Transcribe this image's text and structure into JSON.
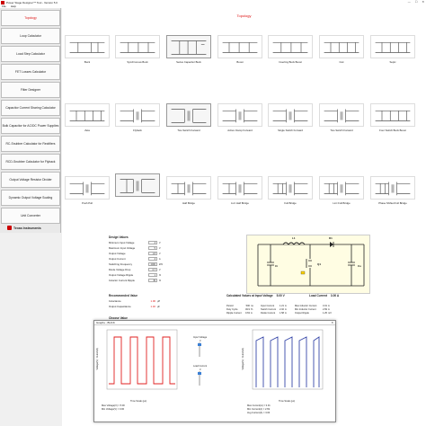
{
  "window": {
    "title": "Power Stage Designer™ Tool - Version 5.0",
    "minimize": "—",
    "maximize": "☐",
    "close": "✕"
  },
  "menu": [
    "File",
    "Help"
  ],
  "sidebar": {
    "items": [
      {
        "label": "Topology",
        "active": true
      },
      {
        "label": "Loop Calculator"
      },
      {
        "label": "Load Step Calculator"
      },
      {
        "label": "FET Losses Calculator"
      },
      {
        "label": "Filter Designer"
      },
      {
        "label": "Capacitor Current Sharing Calculator"
      },
      {
        "label": "Bulk Capacitor for AC/DC Power Supplies"
      },
      {
        "label": "RC-Snubber Calculator for Rectifiers"
      },
      {
        "label": "RCD-Snubber Calculator for Flyback"
      },
      {
        "label": "Output Voltage Resistor Divider"
      },
      {
        "label": "Dynamic Output Voltage Scaling"
      },
      {
        "label": "Unit Converter"
      }
    ],
    "logo_text": "Texas Instruments"
  },
  "main": {
    "title": "Topology",
    "topologies": [
      {
        "label": "Buck"
      },
      {
        "label": "Synchronous Buck"
      },
      {
        "label": "Series Capacitor Buck"
      },
      {
        "label": "Boost"
      },
      {
        "label": "Inverting Buck Boost"
      },
      {
        "label": "Cuk"
      },
      {
        "label": "Sepic"
      },
      {
        "label": "Zeta"
      },
      {
        "label": "Flyback"
      },
      {
        "label": "Two Switch Forward"
      },
      {
        "label": "Active Clamp Forward"
      },
      {
        "label": "Single Switch Forward"
      },
      {
        "label": "Two Switch Forward"
      },
      {
        "label": "Four Switch Buck Boost"
      },
      {
        "label": "Push Pull"
      },
      {
        "label": "Half Bridge"
      },
      {
        "label": "LLC Half Bridge"
      },
      {
        "label": "Full Bridge"
      },
      {
        "label": "LLC Full Bridge"
      },
      {
        "label": "Phase Shifted Full Bridge"
      }
    ],
    "design_values": {
      "heading": "Design Values",
      "rows": [
        {
          "label": "Minimum Input Voltage",
          "value": "3",
          "unit": "V"
        },
        {
          "label": "Maximum Input Voltage",
          "value": "5",
          "unit": "V"
        },
        {
          "label": "Output Voltage",
          "value": "1.8",
          "unit": "V"
        },
        {
          "label": "Output Current",
          "value": "3",
          "unit": "A"
        },
        {
          "label": "Switching Frequency",
          "value": "2000",
          "unit": "kHz"
        },
        {
          "label": "Diode Voltage Drop",
          "value": "0.7",
          "unit": "V"
        },
        {
          "label": "Output Voltage Ripple",
          "value": "1",
          "unit": "%"
        },
        {
          "label": "Inductor Current Ripple",
          "value": "30",
          "unit": "%"
        }
      ]
    },
    "recommended": {
      "heading": "Recommended Value",
      "rows": [
        {
          "label": "Inductance",
          "value": "1.06",
          "unit": "µH"
        },
        {
          "label": "Output Capacitance",
          "value": "1.32",
          "unit": "µF"
        }
      ]
    },
    "choose": {
      "heading": "Choose Value"
    },
    "calculated": {
      "heading": "Calculated Values at Input Voltage",
      "vin": "5.00",
      "vin_unit": "V",
      "load_heading": "Load Current",
      "load": "3.00",
      "load_unit": "A",
      "rows": [
        [
          "Period",
          "500",
          "ns",
          "Input Current",
          "1.21",
          "A",
          "Max Inductor Current",
          "3.31",
          "A"
        ],
        [
          "Duty Cycle",
          "49.9",
          "%",
          "Switch Current",
          "2.32",
          "A",
          "Min Inductor Current",
          "2.69",
          "A"
        ],
        [
          "Ripple Current",
          "0.63",
          "A",
          "Diode Current",
          "1.58",
          "A",
          "Output Ripple",
          "1.25",
          "mV"
        ]
      ]
    },
    "schematic": {
      "inductor": "L1",
      "diode": "D1",
      "switch": "Q1",
      "input_cap": "Ci",
      "output_cap": "Co"
    }
  },
  "popup": {
    "title": "Graphs - BUCK",
    "close": "✕",
    "left_plot": {
      "ylabel": "Voltage(V) / Current(A)",
      "xlabel": "Time Scale (µs)"
    },
    "right_plot": {
      "ylabel": "Voltage(V) / Current(A)",
      "xlabel": "Time Scale (µs)"
    },
    "middle": {
      "input_voltage": "Input Voltage",
      "input_value": "3",
      "load_current": "Load Current",
      "load_value": "3"
    },
    "left_legend": [
      "Max Voltage(V) = 5.00",
      "Min Voltage(V) = 0.00"
    ],
    "right_legend": [
      "Max Current(A) = 3.31",
      "Min Current(A) = 2.69",
      "Avg Current(A) = 3.00"
    ],
    "colors": {
      "switch_node": "#e02020",
      "inductor": "#3848a8"
    }
  }
}
